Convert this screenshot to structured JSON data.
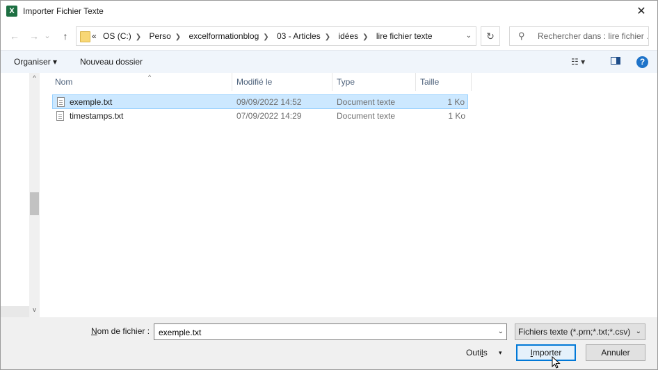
{
  "window": {
    "title": "Importer Fichier Texte",
    "app_icon_letter": "X",
    "close_glyph": "✕"
  },
  "nav": {
    "back_glyph": "←",
    "forward_glyph": "→",
    "recent_glyph": "⌄",
    "up_glyph": "↑",
    "refresh_glyph": "↻",
    "address_dropdown_glyph": "⌄",
    "breadcrumbs": {
      "overflow": "«",
      "items": [
        "OS (C:)",
        "Perso",
        "excelformationblog",
        "03 - Articles",
        "idées",
        "lire fichier texte"
      ]
    },
    "search_placeholder": "Rechercher dans : lire fichier ...",
    "search_glyph": "⚲"
  },
  "toolbar": {
    "organize_label": "Organiser",
    "organize_arrow": "▾",
    "new_folder_label": "Nouveau dossier",
    "view_glyph": "☷ ▾",
    "help_glyph": "?"
  },
  "columns": {
    "name": "Nom",
    "modified": "Modifié le",
    "type": "Type",
    "size": "Taille",
    "sort_glyph": "^"
  },
  "files": [
    {
      "name": "exemple.txt",
      "modified": "09/09/2022 14:52",
      "type": "Document texte",
      "size": "1 Ko",
      "selected": true
    },
    {
      "name": "timestamps.txt",
      "modified": "07/09/2022 14:29",
      "type": "Document texte",
      "size": "1 Ko",
      "selected": false
    }
  ],
  "scroll": {
    "up_glyph": "^",
    "down_glyph": "v"
  },
  "footer": {
    "filename_label_prefix": "N",
    "filename_label_rest": "om de fichier :",
    "filename_value": "exemple.txt",
    "filename_dropdown_glyph": "⌄",
    "filetype_value": "Fichiers texte (*.prn;*.txt;*.csv)",
    "filetype_dropdown_glyph": "⌄",
    "tools_label_pre": "Outi",
    "tools_label_ul": "l",
    "tools_label_post": "s",
    "tools_arrow": "▾",
    "import_label_ul": "I",
    "import_label_rest": "mporter",
    "cancel_label": "Annuler"
  },
  "colors": {
    "selection": "#cce8ff",
    "accent": "#0078d7",
    "excel_green": "#1d6f42"
  }
}
